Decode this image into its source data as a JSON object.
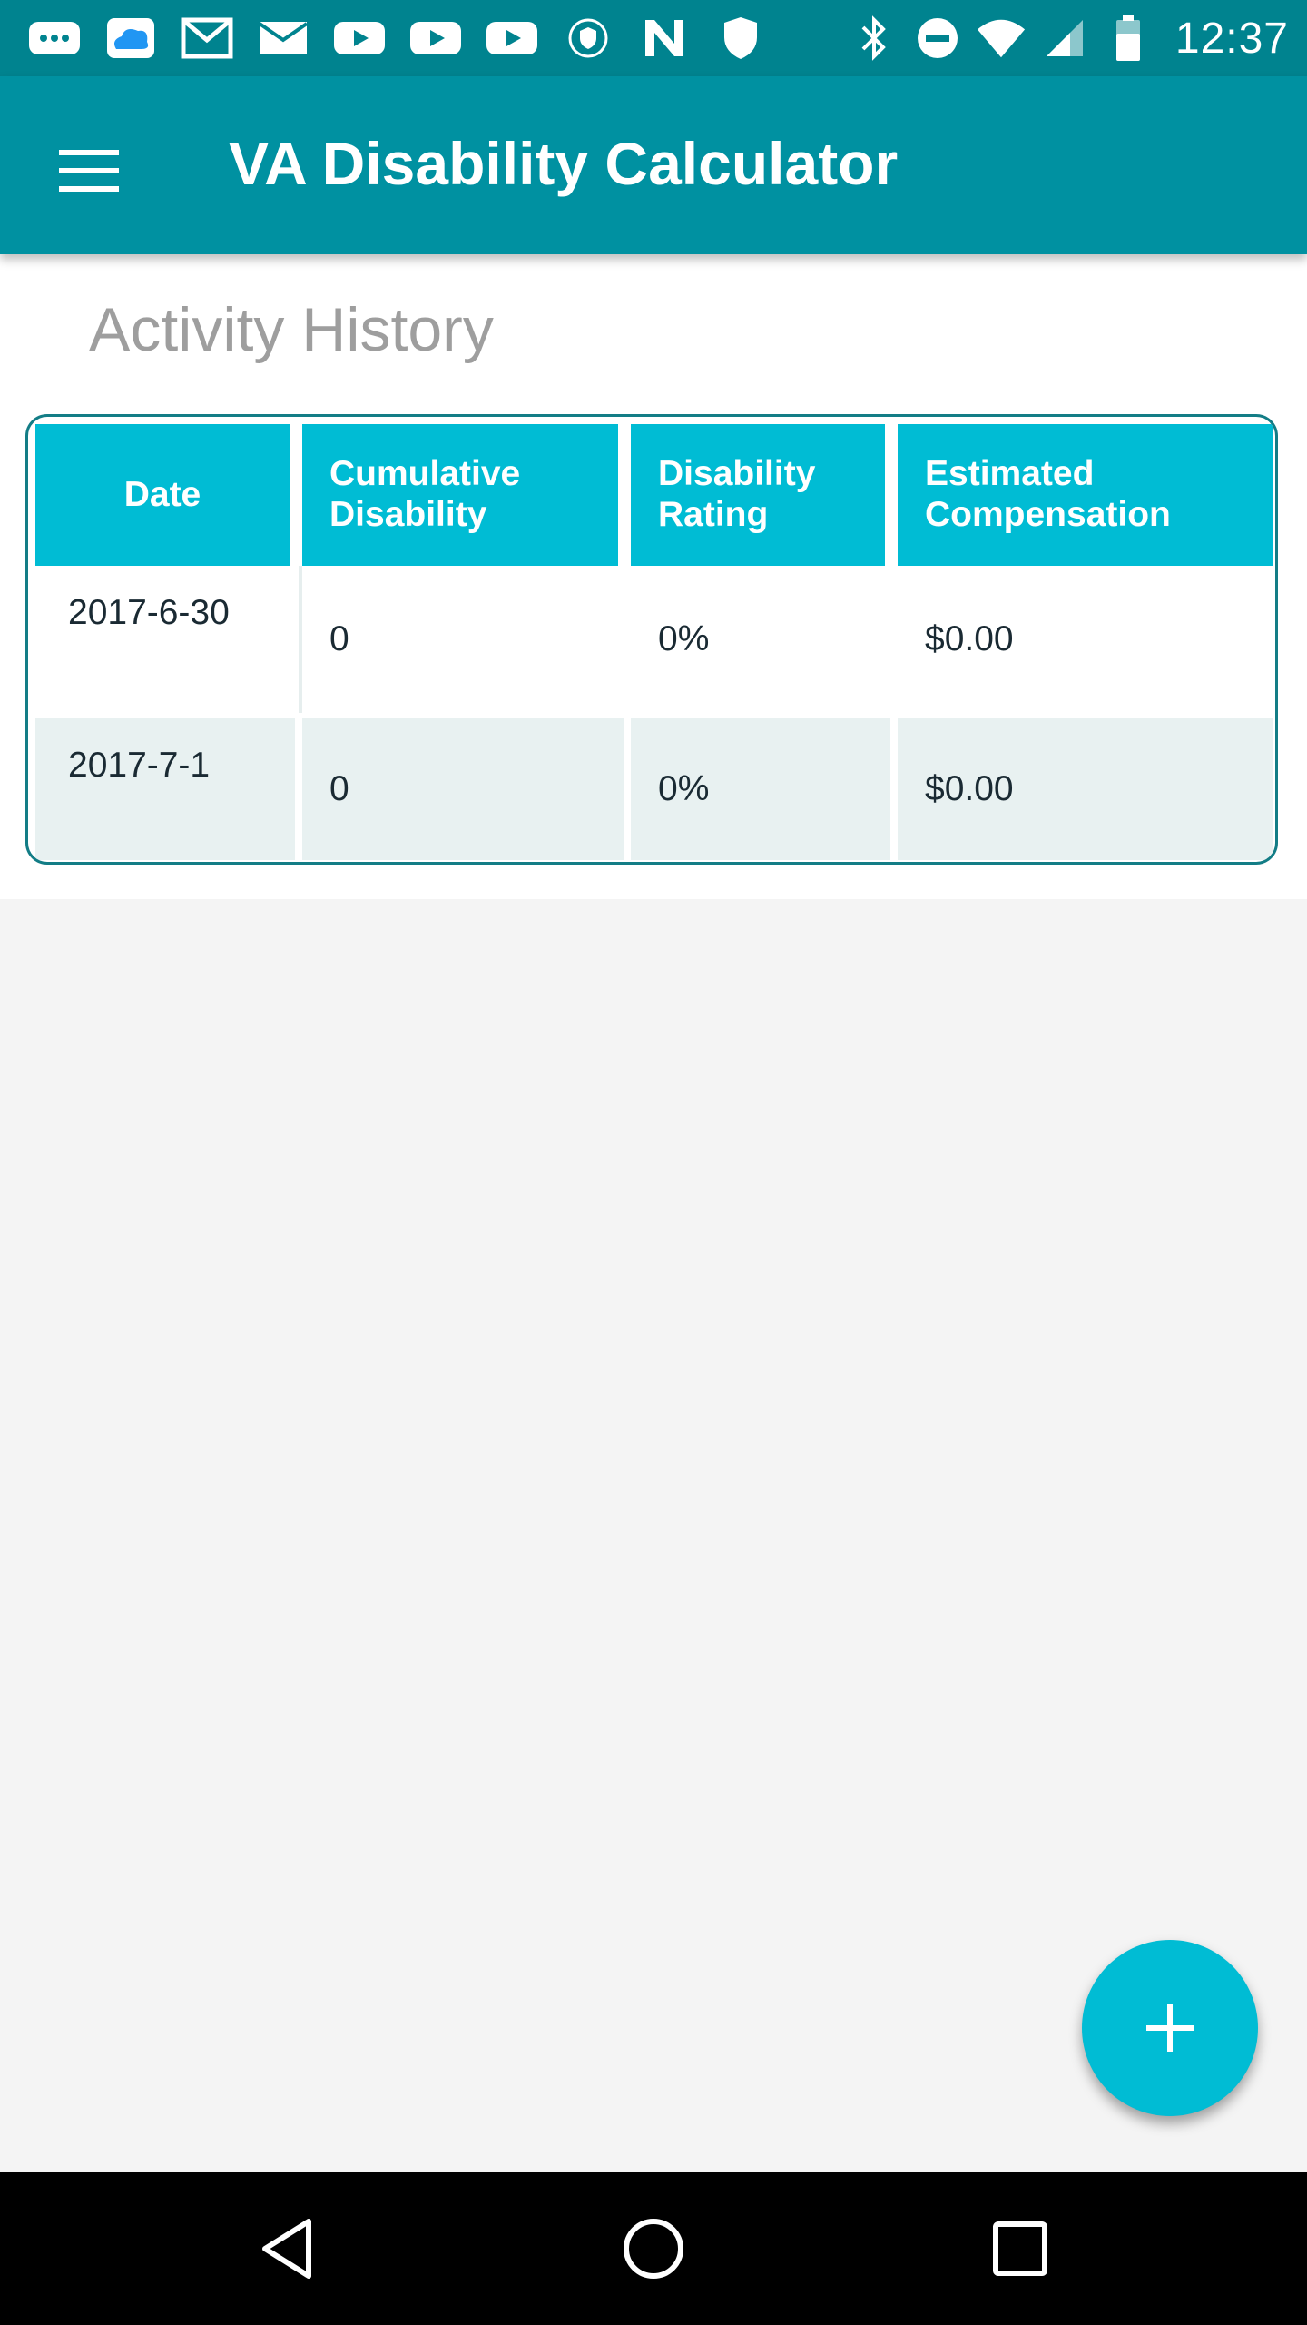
{
  "status_bar": {
    "time": "12:37",
    "notification_icons": [
      "chat-icon",
      "cloud-app-icon",
      "gmail-icon",
      "email-icon",
      "youtube-icon",
      "youtube-icon",
      "youtube-icon",
      "vpn-shield-icon",
      "n-app-icon",
      "shield-icon"
    ],
    "system_icons": [
      "bluetooth-icon",
      "do-not-disturb-icon",
      "wifi-icon",
      "signal-icon",
      "battery-icon"
    ]
  },
  "app_bar": {
    "title": "VA Disability Calculator"
  },
  "section": {
    "title": "Activity History"
  },
  "table": {
    "headers": {
      "date": "Date",
      "cumulative": "Cumulative Disability",
      "rating": "Disability Rating",
      "compensation": "Estimated Compensation"
    },
    "rows": [
      {
        "date": "2017-6-30",
        "cumulative": "0",
        "rating": "0%",
        "compensation": "$0.00"
      },
      {
        "date": "2017-7-1",
        "cumulative": "0",
        "rating": "0%",
        "compensation": "$0.00"
      }
    ]
  },
  "colors": {
    "status_bar": "#00838f",
    "app_bar": "#0091a1",
    "accent": "#00bcd4",
    "table_border": "#137d86",
    "row_alt": "#e8f1f1"
  }
}
